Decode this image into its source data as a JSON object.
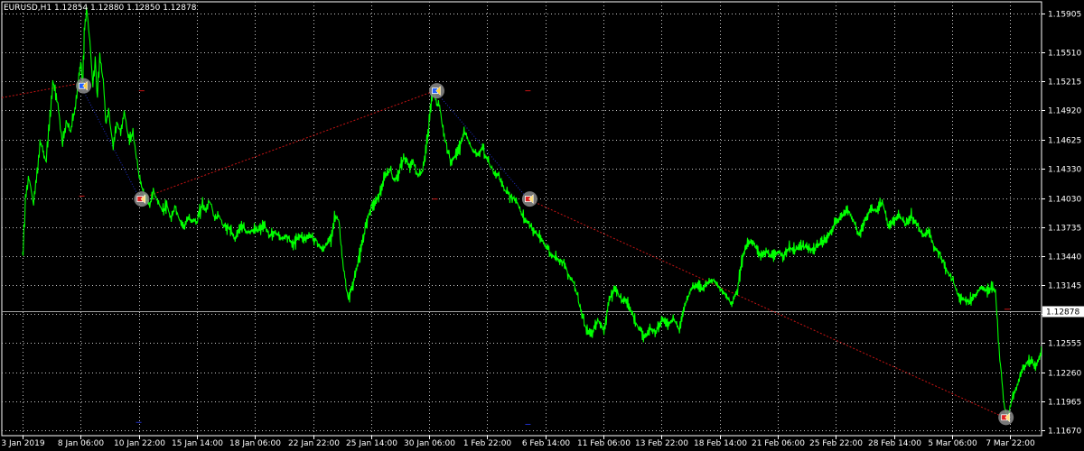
{
  "header": {
    "symbol_info": "EURUSD,H1  1.12854 1.12880 1.12850 1.12878"
  },
  "colors": {
    "background": "#000000",
    "grid": "#c8c8c8",
    "price_line": "#00ff00",
    "axis": "#ffffff",
    "trade_line": "#c81414",
    "current_price_line": "#a0a0a0"
  },
  "chart_data": {
    "type": "line",
    "title": "",
    "xlabel": "",
    "ylabel": "",
    "grid": true,
    "ylim": [
      1.1167,
      1.15905
    ],
    "x_ticks": [
      {
        "label": "3 Jan 2019",
        "x": 0
      },
      {
        "label": "8 Jan 06:00",
        "x": 1
      },
      {
        "label": "10 Jan 22:00",
        "x": 2
      },
      {
        "label": "15 Jan 14:00",
        "x": 3
      },
      {
        "label": "18 Jan 06:00",
        "x": 4
      },
      {
        "label": "22 Jan 22:00",
        "x": 5
      },
      {
        "label": "25 Jan 14:00",
        "x": 6
      },
      {
        "label": "30 Jan 06:00",
        "x": 7
      },
      {
        "label": "1 Feb 22:00",
        "x": 8
      },
      {
        "label": "6 Feb 14:00",
        "x": 9
      },
      {
        "label": "11 Feb 06:00",
        "x": 10
      },
      {
        "label": "13 Feb 22:00",
        "x": 11
      },
      {
        "label": "18 Feb 14:00",
        "x": 12
      },
      {
        "label": "21 Feb 06:00",
        "x": 13
      },
      {
        "label": "25 Feb 22:00",
        "x": 14
      },
      {
        "label": "28 Feb 14:00",
        "x": 15
      },
      {
        "label": "5 Mar 06:00",
        "x": 16
      },
      {
        "label": "7 Mar 22:00",
        "x": 17
      }
    ],
    "y_ticks": [
      1.15905,
      1.1551,
      1.15215,
      1.1492,
      1.14625,
      1.1433,
      1.1403,
      1.13735,
      1.1344,
      1.13145,
      1.1285,
      1.12555,
      1.1226,
      1.11965,
      1.1167
    ],
    "y_tick_labels": [
      "1.15905",
      "1.15510",
      "1.15215",
      "1.14920",
      "1.14625",
      "1.14330",
      "1.14030",
      "1.13735",
      "1.13440",
      "1.13145",
      "1.12850",
      "1.12555",
      "1.12260",
      "1.11965",
      "1.11670"
    ],
    "current_price": 1.12878,
    "current_price_label": "1.12878",
    "series": [
      {
        "values": [
          [
            0.0,
            1.1345
          ],
          [
            0.05,
            1.1405
          ],
          [
            0.1,
            1.1425
          ],
          [
            0.18,
            1.1398
          ],
          [
            0.25,
            1.143
          ],
          [
            0.3,
            1.146
          ],
          [
            0.4,
            1.144
          ],
          [
            0.45,
            1.1475
          ],
          [
            0.52,
            1.152
          ],
          [
            0.6,
            1.15
          ],
          [
            0.68,
            1.146
          ],
          [
            0.75,
            1.148
          ],
          [
            0.82,
            1.147
          ],
          [
            0.9,
            1.1495
          ],
          [
            0.97,
            1.153
          ],
          [
            1.0,
            1.154
          ],
          [
            1.03,
            1.152
          ],
          [
            1.06,
            1.1575
          ],
          [
            1.1,
            1.1595
          ],
          [
            1.15,
            1.1565
          ],
          [
            1.2,
            1.152
          ],
          [
            1.25,
            1.154
          ],
          [
            1.28,
            1.151
          ],
          [
            1.33,
            1.1545
          ],
          [
            1.38,
            1.1525
          ],
          [
            1.43,
            1.148
          ],
          [
            1.48,
            1.149
          ],
          [
            1.55,
            1.1455
          ],
          [
            1.62,
            1.148
          ],
          [
            1.68,
            1.147
          ],
          [
            1.75,
            1.149
          ],
          [
            1.83,
            1.146
          ],
          [
            1.9,
            1.147
          ],
          [
            1.95,
            1.1445
          ],
          [
            2.02,
            1.142
          ],
          [
            2.1,
            1.1405
          ],
          [
            2.18,
            1.1395
          ],
          [
            2.25,
            1.141
          ],
          [
            2.32,
            1.14
          ],
          [
            2.4,
            1.139
          ],
          [
            2.48,
            1.1395
          ],
          [
            2.55,
            1.138
          ],
          [
            2.62,
            1.1395
          ],
          [
            2.7,
            1.138
          ],
          [
            2.78,
            1.1375
          ],
          [
            2.85,
            1.1382
          ],
          [
            2.95,
            1.138
          ],
          [
            3.0,
            1.1378
          ],
          [
            3.05,
            1.139
          ],
          [
            3.1,
            1.1398
          ],
          [
            3.15,
            1.139
          ],
          [
            3.2,
            1.14
          ],
          [
            3.25,
            1.1395
          ],
          [
            3.3,
            1.1382
          ],
          [
            3.38,
            1.1385
          ],
          [
            3.45,
            1.1375
          ],
          [
            3.55,
            1.1372
          ],
          [
            3.65,
            1.1362
          ],
          [
            3.75,
            1.1375
          ],
          [
            3.85,
            1.1368
          ],
          [
            3.95,
            1.137
          ],
          [
            4.05,
            1.137
          ],
          [
            4.15,
            1.1375
          ],
          [
            4.25,
            1.1365
          ],
          [
            4.35,
            1.1368
          ],
          [
            4.45,
            1.1362
          ],
          [
            4.55,
            1.1365
          ],
          [
            4.65,
            1.1355
          ],
          [
            4.75,
            1.1365
          ],
          [
            4.85,
            1.1362
          ],
          [
            4.95,
            1.1365
          ],
          [
            5.05,
            1.136
          ],
          [
            5.15,
            1.135
          ],
          [
            5.22,
            1.1355
          ],
          [
            5.3,
            1.1362
          ],
          [
            5.37,
            1.1385
          ],
          [
            5.44,
            1.138
          ],
          [
            5.52,
            1.133
          ],
          [
            5.6,
            1.13
          ],
          [
            5.68,
            1.1315
          ],
          [
            5.76,
            1.1335
          ],
          [
            5.84,
            1.1355
          ],
          [
            5.92,
            1.138
          ],
          [
            6.0,
            1.1395
          ],
          [
            6.08,
            1.14
          ],
          [
            6.16,
            1.141
          ],
          [
            6.24,
            1.1425
          ],
          [
            6.32,
            1.1432
          ],
          [
            6.4,
            1.142
          ],
          [
            6.48,
            1.143
          ],
          [
            6.56,
            1.1445
          ],
          [
            6.64,
            1.1435
          ],
          [
            6.72,
            1.144
          ],
          [
            6.8,
            1.1425
          ],
          [
            6.88,
            1.143
          ],
          [
            6.96,
            1.146
          ],
          [
            7.02,
            1.1495
          ],
          [
            7.06,
            1.1515
          ],
          [
            7.12,
            1.15
          ],
          [
            7.18,
            1.1495
          ],
          [
            7.24,
            1.147
          ],
          [
            7.3,
            1.1455
          ],
          [
            7.36,
            1.144
          ],
          [
            7.44,
            1.1445
          ],
          [
            7.52,
            1.1455
          ],
          [
            7.6,
            1.147
          ],
          [
            7.68,
            1.146
          ],
          [
            7.76,
            1.145
          ],
          [
            7.84,
            1.1448
          ],
          [
            7.92,
            1.1455
          ],
          [
            8.0,
            1.144
          ],
          [
            8.1,
            1.143
          ],
          [
            8.2,
            1.1425
          ],
          [
            8.3,
            1.141
          ],
          [
            8.4,
            1.1405
          ],
          [
            8.5,
            1.14
          ],
          [
            8.6,
            1.1385
          ],
          [
            8.7,
            1.1378
          ],
          [
            8.8,
            1.137
          ],
          [
            8.9,
            1.1362
          ],
          [
            9.0,
            1.1355
          ],
          [
            9.1,
            1.1345
          ],
          [
            9.2,
            1.1342
          ],
          [
            9.3,
            1.1338
          ],
          [
            9.4,
            1.1325
          ],
          [
            9.5,
            1.1315
          ],
          [
            9.6,
            1.129
          ],
          [
            9.7,
            1.1268
          ],
          [
            9.8,
            1.1265
          ],
          [
            9.9,
            1.128
          ],
          [
            10.0,
            1.1268
          ],
          [
            10.1,
            1.13
          ],
          [
            10.2,
            1.1312
          ],
          [
            10.3,
            1.13
          ],
          [
            10.4,
            1.1298
          ],
          [
            10.5,
            1.1285
          ],
          [
            10.6,
            1.127
          ],
          [
            10.7,
            1.1262
          ],
          [
            10.8,
            1.127
          ],
          [
            10.9,
            1.1268
          ],
          [
            11.0,
            1.128
          ],
          [
            11.1,
            1.1275
          ],
          [
            11.2,
            1.128
          ],
          [
            11.3,
            1.127
          ],
          [
            11.4,
            1.1295
          ],
          [
            11.5,
            1.131
          ],
          [
            11.6,
            1.1315
          ],
          [
            11.7,
            1.1312
          ],
          [
            11.8,
            1.1318
          ],
          [
            11.9,
            1.132
          ],
          [
            12.0,
            1.131
          ],
          [
            12.1,
            1.1305
          ],
          [
            12.2,
            1.1295
          ],
          [
            12.3,
            1.131
          ],
          [
            12.4,
            1.1345
          ],
          [
            12.5,
            1.136
          ],
          [
            12.6,
            1.1355
          ],
          [
            12.7,
            1.1345
          ],
          [
            12.8,
            1.1348
          ],
          [
            12.9,
            1.1342
          ],
          [
            13.0,
            1.1348
          ],
          [
            13.1,
            1.1345
          ],
          [
            13.2,
            1.1352
          ],
          [
            13.3,
            1.135
          ],
          [
            13.4,
            1.1355
          ],
          [
            13.5,
            1.1352
          ],
          [
            13.6,
            1.135
          ],
          [
            13.7,
            1.1355
          ],
          [
            13.8,
            1.136
          ],
          [
            13.9,
            1.1368
          ],
          [
            14.0,
            1.1378
          ],
          [
            14.1,
            1.1385
          ],
          [
            14.2,
            1.1392
          ],
          [
            14.3,
            1.138
          ],
          [
            14.4,
            1.1365
          ],
          [
            14.5,
            1.138
          ],
          [
            14.6,
            1.1392
          ],
          [
            14.7,
            1.139
          ],
          [
            14.8,
            1.1398
          ],
          [
            14.9,
            1.1375
          ],
          [
            15.0,
            1.138
          ],
          [
            15.1,
            1.1385
          ],
          [
            15.2,
            1.1375
          ],
          [
            15.3,
            1.1385
          ],
          [
            15.4,
            1.1375
          ],
          [
            15.5,
            1.1365
          ],
          [
            15.6,
            1.1368
          ],
          [
            15.7,
            1.1352
          ],
          [
            15.8,
            1.1345
          ],
          [
            15.9,
            1.133
          ],
          [
            16.0,
            1.132
          ],
          [
            16.1,
            1.1305
          ],
          [
            16.2,
            1.13
          ],
          [
            16.3,
            1.1298
          ],
          [
            16.4,
            1.1305
          ],
          [
            16.5,
            1.1312
          ],
          [
            16.6,
            1.1308
          ],
          [
            16.7,
            1.1312
          ],
          [
            16.75,
            1.1305
          ],
          [
            16.8,
            1.1255
          ],
          [
            16.85,
            1.122
          ],
          [
            16.9,
            1.119
          ],
          [
            16.95,
            1.118
          ],
          [
            17.0,
            1.1192
          ],
          [
            17.05,
            1.1202
          ],
          [
            17.1,
            1.121
          ],
          [
            17.15,
            1.1218
          ],
          [
            17.2,
            1.1228
          ],
          [
            17.28,
            1.1235
          ],
          [
            17.35,
            1.1238
          ],
          [
            17.43,
            1.1232
          ],
          [
            17.5,
            1.124
          ],
          [
            17.58,
            1.125
          ],
          [
            17.66,
            1.1258
          ],
          [
            17.74,
            1.126
          ],
          [
            17.82,
            1.127
          ],
          [
            17.9,
            1.1275
          ],
          [
            17.96,
            1.1282
          ],
          [
            18.02,
            1.1288
          ]
        ]
      }
    ],
    "trade_lines": [
      {
        "x1": -0.9,
        "y1": 1.1505,
        "x2": 1.02,
        "y2": 1.152,
        "style": "dashed"
      },
      {
        "x1": 1.02,
        "y1": 1.1515,
        "x2": 2.02,
        "y2": 1.1402,
        "style": "dotted-blue"
      },
      {
        "x1": 2.02,
        "y1": 1.1402,
        "x2": 7.1,
        "y2": 1.1512,
        "style": "dashed"
      },
      {
        "x1": 7.1,
        "y1": 1.1512,
        "x2": 8.7,
        "y2": 1.1402,
        "style": "dotted-blue"
      },
      {
        "x1": 8.7,
        "y1": 1.1402,
        "x2": 16.9,
        "y2": 1.118,
        "style": "dashed"
      }
    ],
    "markers": [
      {
        "x": 1.02,
        "y": 1.1517,
        "kind": "buy"
      },
      {
        "x": 2.02,
        "y": 1.1402,
        "kind": "sell"
      },
      {
        "x": 7.1,
        "y": 1.1512,
        "kind": "buy"
      },
      {
        "x": 8.7,
        "y": 1.1402,
        "kind": "sell"
      },
      {
        "x": 16.9,
        "y": 1.118,
        "kind": "sell"
      }
    ],
    "level_dashes": [
      {
        "x": 2.05,
        "y": 1.1512,
        "color": "red"
      },
      {
        "x": 1.02,
        "y": 1.1405,
        "color": "red"
      },
      {
        "x": 7.1,
        "y": 1.1402,
        "color": "red"
      },
      {
        "x": 8.7,
        "y": 1.1512,
        "color": "red"
      },
      {
        "x": 16.95,
        "y": 1.129,
        "color": "red"
      },
      {
        "x": 2.0,
        "y": 1.1175,
        "color": "blue"
      },
      {
        "x": 8.7,
        "y": 1.1173,
        "color": "blue"
      }
    ]
  }
}
